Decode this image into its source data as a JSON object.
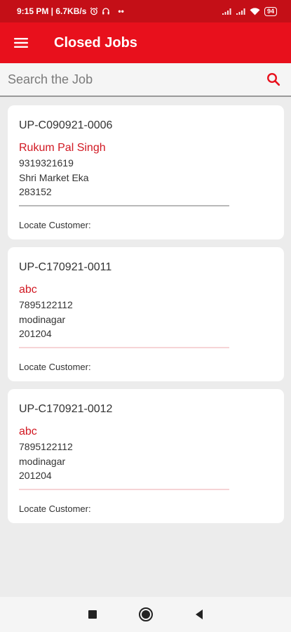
{
  "status_bar": {
    "time_speed": "9:15 PM | 6.7KB/s",
    "more": "••",
    "battery": "94"
  },
  "app_bar": {
    "title": "Closed Jobs"
  },
  "search": {
    "placeholder": "Search the Job"
  },
  "jobs": [
    {
      "id": "UP-C090921-0006",
      "customer": "Rukum Pal Singh",
      "phone": "9319321619",
      "address": "Shri Market Eka",
      "pincode": "283152",
      "locate_label": "Locate Customer:"
    },
    {
      "id": "UP-C170921-0011",
      "customer": "abc",
      "phone": "7895122112",
      "address": "modinagar",
      "pincode": "201204",
      "locate_label": "Locate Customer:"
    },
    {
      "id": "UP-C170921-0012",
      "customer": "abc",
      "phone": "7895122112",
      "address": "modinagar",
      "pincode": "201204",
      "locate_label": "Locate Customer:"
    }
  ],
  "colors": {
    "status_bar": "#c40f17",
    "app_bar": "#e8101c",
    "accent": "#d11822",
    "background": "#ececec",
    "divider_first": "#b9b9b9",
    "divider_other": "#f6d4d6"
  },
  "icons": {
    "menu": "hamburger-menu-icon",
    "search": "search-icon",
    "nav": [
      "square-recents-icon",
      "circle-home-icon",
      "triangle-back-icon"
    ]
  }
}
